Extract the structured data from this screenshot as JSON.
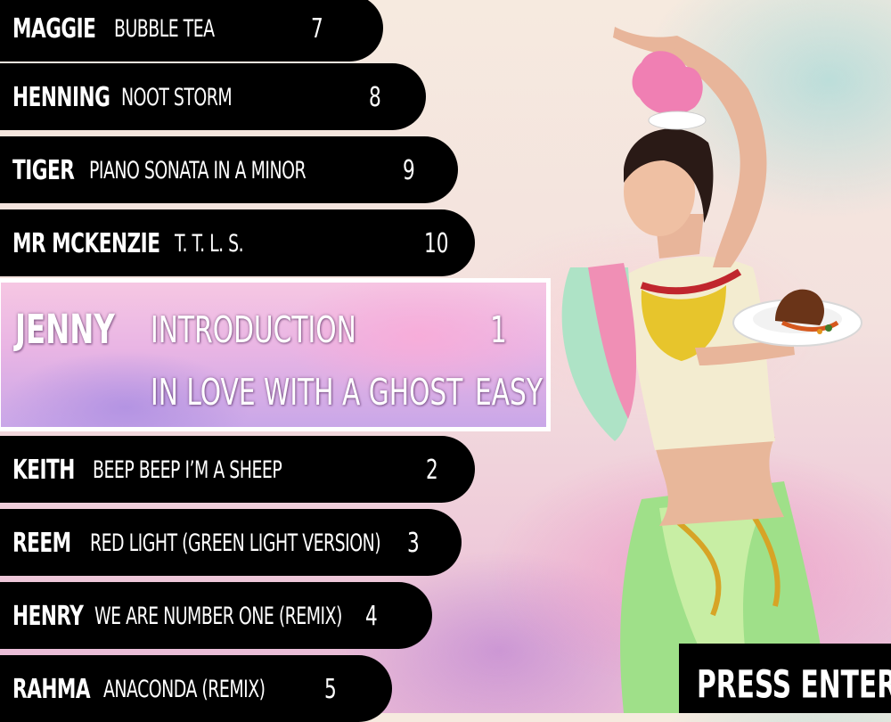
{
  "rows_top": [
    {
      "name": "MAGGIE",
      "song": "BUBBLE  TEA",
      "number": "7"
    },
    {
      "name": "HENNING",
      "song": "NOOT STORM",
      "number": "8"
    },
    {
      "name": "TIGER",
      "song": "PIANO SONATA IN A MINOR",
      "number": "9"
    },
    {
      "name": "MR MCKENZIE",
      "song": "T. T. L. S.",
      "number": "10"
    }
  ],
  "selected": {
    "name": "JENNY",
    "song": "INTRODUCTION",
    "number": "1",
    "song_2": "IN LOVE WITH A GHOST",
    "difficulty": "EASY"
  },
  "rows_bottom": [
    {
      "name": "KEITH",
      "song": "BEEP BEEP I’M A SHEEP",
      "number": "2"
    },
    {
      "name": "REEM",
      "song": "RED LIGHT  (GREEN LIGHT VERSION)",
      "number": "3"
    },
    {
      "name": "HENRY",
      "song": "WE ARE NUMBER ONE  (REMIX)",
      "number": "4"
    },
    {
      "name": "RAHMA",
      "song": "ANACONDA  (REMIX)",
      "number": "5"
    }
  ],
  "press_enter": "PRESS ENTER",
  "colors": {
    "row_bg": "#000000",
    "text": "#ffffff",
    "highlight_border": "#ffffff"
  }
}
